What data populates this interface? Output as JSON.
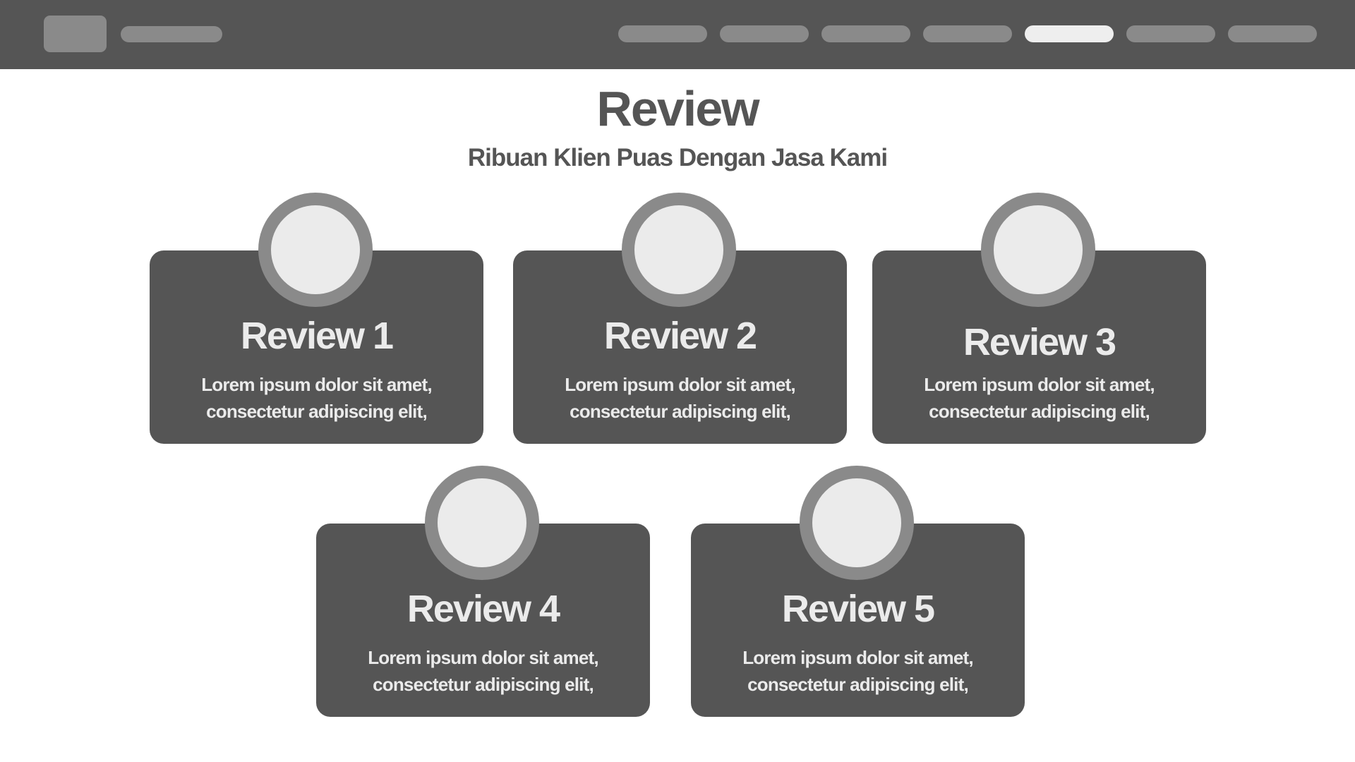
{
  "header": {
    "nav_item_count": 7,
    "active_nav_index": 4
  },
  "page": {
    "title": "Review",
    "subtitle": "Ribuan Klien Puas Dengan Jasa Kami"
  },
  "reviews": [
    {
      "title": "Review 1",
      "line1": "Lorem ipsum dolor sit amet,",
      "line2": "consectetur adipiscing elit,"
    },
    {
      "title": "Review 2",
      "line1": "Lorem ipsum dolor sit amet,",
      "line2": "consectetur adipiscing elit,"
    },
    {
      "title": "Review 3",
      "line1": "Lorem ipsum dolor sit amet,",
      "line2": "consectetur adipiscing elit,"
    },
    {
      "title": "Review 4",
      "line1": "Lorem ipsum dolor sit amet,",
      "line2": "consectetur adipiscing elit,"
    },
    {
      "title": "Review 5",
      "line1": "Lorem ipsum dolor sit amet,",
      "line2": "consectetur adipiscing elit,"
    }
  ],
  "colors": {
    "navbar": "#555555",
    "placeholder": "#8a8a8a",
    "active_nav": "#eeeeee",
    "card": "#555555",
    "avatar_fill": "#ebebeb",
    "text_light": "#ebebeb",
    "text_dark": "#555555"
  }
}
